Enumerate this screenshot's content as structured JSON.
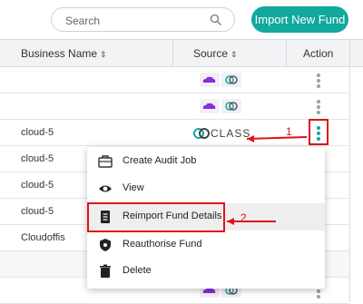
{
  "search": {
    "placeholder": "Search",
    "icon": "search-icon"
  },
  "toolbar": {
    "import_label": "Import New Fund"
  },
  "table": {
    "columns": [
      {
        "label": "Business Name",
        "sort_icon": "sort-icon"
      },
      {
        "label": "Source",
        "sort_icon": "sort-icon"
      },
      {
        "label": "Action"
      }
    ],
    "rows": [
      {
        "name": "",
        "source": "badges"
      },
      {
        "name": "",
        "source": "badges"
      },
      {
        "name": "cloud-5",
        "source": "CLASS"
      },
      {
        "name": "cloud-5",
        "source": ""
      },
      {
        "name": "cloud-5",
        "source": ""
      },
      {
        "name": "cloud-5",
        "source": ""
      },
      {
        "name": "Cloudoffis",
        "source": ""
      },
      {
        "name": "",
        "source": ""
      },
      {
        "name": "",
        "source": "badges"
      }
    ]
  },
  "source_logo_text": "CLASS",
  "menu": {
    "items": [
      {
        "label": "Create Audit Job",
        "icon": "briefcase-icon"
      },
      {
        "label": "View",
        "icon": "eye-icon"
      },
      {
        "label": "Reimport Fund Details",
        "icon": "document-icon"
      },
      {
        "label": "Reauthorise Fund",
        "icon": "shield-icon"
      },
      {
        "label": "Delete",
        "icon": "trash-icon"
      }
    ]
  },
  "annotations": {
    "one": "1",
    "two": "2"
  },
  "colors": {
    "accent": "#12a89d",
    "annotation": "#e0131a",
    "badge_purple": "#8a2be2"
  }
}
